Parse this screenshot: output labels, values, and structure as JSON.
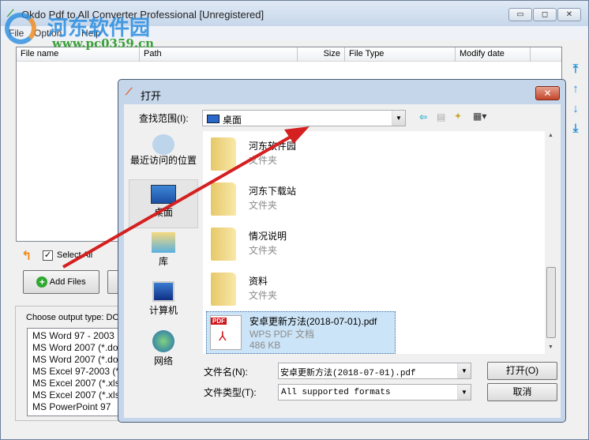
{
  "window": {
    "title": "Okdo Pdf to All Converter Professional [Unregistered]",
    "minimize": "▭",
    "maximize": "◻",
    "close": "✕"
  },
  "menu": [
    "File",
    "Option",
    "Help"
  ],
  "table": {
    "columns": [
      "File name",
      "Path",
      "Size",
      "File Type",
      "Modify date"
    ]
  },
  "select_all": "Select All",
  "add_files": "Add Files",
  "output": {
    "label": "Choose output type:  DO",
    "items": [
      "MS Word 97 - 2003",
      "MS Word 2007 (*.do",
      "MS Word 2007 (*.do",
      "MS Excel 97-2003 (*",
      "MS Excel 2007 (*.xls",
      "MS Excel 2007 (*.xls",
      "MS PowerPoint 97"
    ]
  },
  "dialog": {
    "title": "打开",
    "close": "✕",
    "look_in_label": "查找范围(I):",
    "look_in_value": "桌面",
    "places": [
      "最近访问的位置",
      "桌面",
      "库",
      "计算机",
      "网络"
    ],
    "files": [
      {
        "name": "河东软件园",
        "type": "文件夹"
      },
      {
        "name": "河东下载站",
        "type": "文件夹"
      },
      {
        "name": "情况说明",
        "type": "文件夹"
      },
      {
        "name": "资料",
        "type": "文件夹"
      },
      {
        "name": "安卓更新方法(2018-07-01).pdf",
        "type": "WPS PDF 文档",
        "size": "486 KB",
        "badge": "PDF"
      }
    ],
    "filename_label": "文件名(N):",
    "filename_value": "安卓更新方法(2018-07-01).pdf",
    "filetype_label": "文件类型(T):",
    "filetype_value": "All supported formats",
    "open": "打开(O)",
    "cancel": "取消"
  },
  "watermark": {
    "name": "河东软件园",
    "url": "www.pc0359.cn"
  },
  "colors": {
    "accent": "#1e8fd8",
    "arrow": "#d42020",
    "selection": "#cce4f7"
  }
}
